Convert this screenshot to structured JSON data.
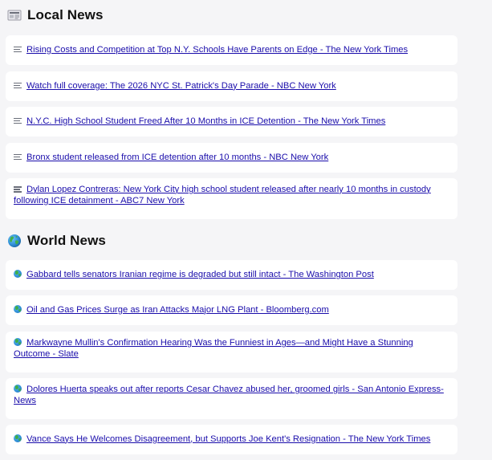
{
  "sections": [
    {
      "title": "Local News",
      "icon": "newspaper-icon",
      "items": [
        "Rising Costs and Competition at Top N.Y. Schools Have Parents on Edge - The New York Times",
        "Watch full coverage: The 2026 NYC St. Patrick's Day Parade - NBC New York",
        "N.Y.C. High School Student Freed After 10 Months in ICE Detention - The New York Times",
        "Bronx student released from ICE detention after 10 months - NBC New York",
        "Dylan Lopez Contreras: New York City high school student released after nearly 10 months in custody following ICE detainment - ABC7 New York"
      ]
    },
    {
      "title": "World News",
      "icon": "globe-icon",
      "items": [
        "Gabbard tells senators Iranian regime is degraded but still intact - The Washington Post",
        "Oil and Gas Prices Surge as Iran Attacks Major LNG Plant - Bloomberg.com",
        "Markwayne Mullin's Confirmation Hearing Was the Funniest in Ages—and Might Have a Stunning Outcome - Slate",
        "Dolores Huerta speaks out after reports Cesar Chavez abused her, groomed girls - San Antonio Express-News",
        "Vance Says He Welcomes Disagreement, but Supports Joe Kent's Resignation - The New York Times"
      ]
    }
  ]
}
